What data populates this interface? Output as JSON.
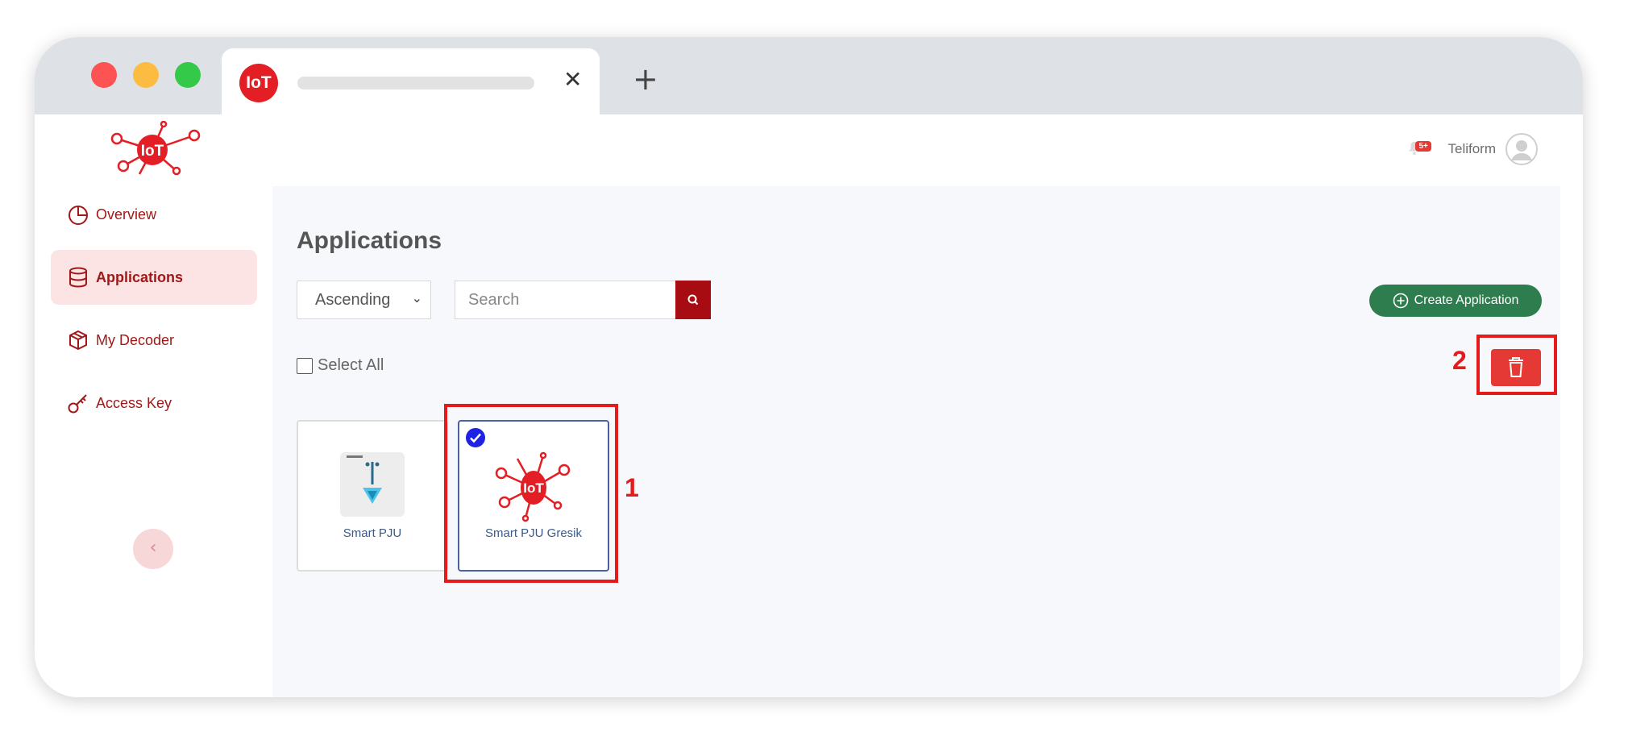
{
  "browser": {
    "tab": {
      "favicon_text": "IoT",
      "close_glyph": "✕"
    },
    "new_tab_glyph": "+"
  },
  "header": {
    "notification_badge": "5+",
    "username": "Teliform"
  },
  "sidebar": {
    "items": [
      {
        "label": "Overview",
        "icon": "pie-chart-icon",
        "active": false
      },
      {
        "label": "Applications",
        "icon": "database-icon",
        "active": true
      },
      {
        "label": "My Decoder",
        "icon": "cube-icon",
        "active": false
      },
      {
        "label": "Access Key",
        "icon": "key-icon",
        "active": false
      }
    ],
    "collapse_glyph": "‹"
  },
  "main": {
    "title": "Applications",
    "sort": {
      "selected": "Ascending"
    },
    "search": {
      "placeholder": "Search"
    },
    "create_button": "Create Application",
    "select_all_label": "Select All",
    "cards": [
      {
        "name": "Smart PJU",
        "selected": false
      },
      {
        "name": "Smart PJU Gresik",
        "selected": true
      }
    ]
  },
  "annotations": {
    "card_marker": "1",
    "delete_marker": "2"
  },
  "colors": {
    "brand_red": "#a70c12",
    "accent_red": "#e53935",
    "create_green": "#2e7d4f",
    "annotation_red": "#e51b1b",
    "active_nav_bg": "#fde4e4"
  }
}
